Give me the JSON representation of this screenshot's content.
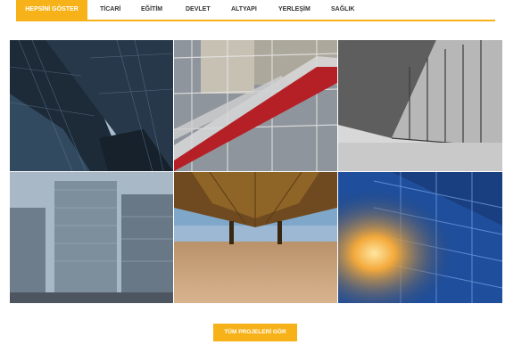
{
  "filter_tabs": [
    {
      "label": "HEPSİNİ GÖSTER",
      "active": true
    },
    {
      "label": "TİCARİ",
      "active": false
    },
    {
      "label": "EĞİTİM",
      "active": false
    },
    {
      "label": "DEVLET",
      "active": false
    },
    {
      "label": "ALTYAPI",
      "active": false
    },
    {
      "label": "YERLEŞİM",
      "active": false
    },
    {
      "label": "SAĞLIK",
      "active": false
    }
  ],
  "gallery": {
    "tiles": [
      {
        "subject": "glass skyscrapers looking up"
      },
      {
        "subject": "building exterior with red escalator tube"
      },
      {
        "subject": "modern glass and steel facade"
      },
      {
        "subject": "office tower complex"
      },
      {
        "subject": "view under a pier on a beach"
      },
      {
        "subject": "blue glass building with sunburst"
      }
    ]
  },
  "cta": {
    "label": "TÜM PROJELERİ GÖR"
  },
  "colors": {
    "accent": "#f7b21a",
    "tab_text": "#333333"
  }
}
